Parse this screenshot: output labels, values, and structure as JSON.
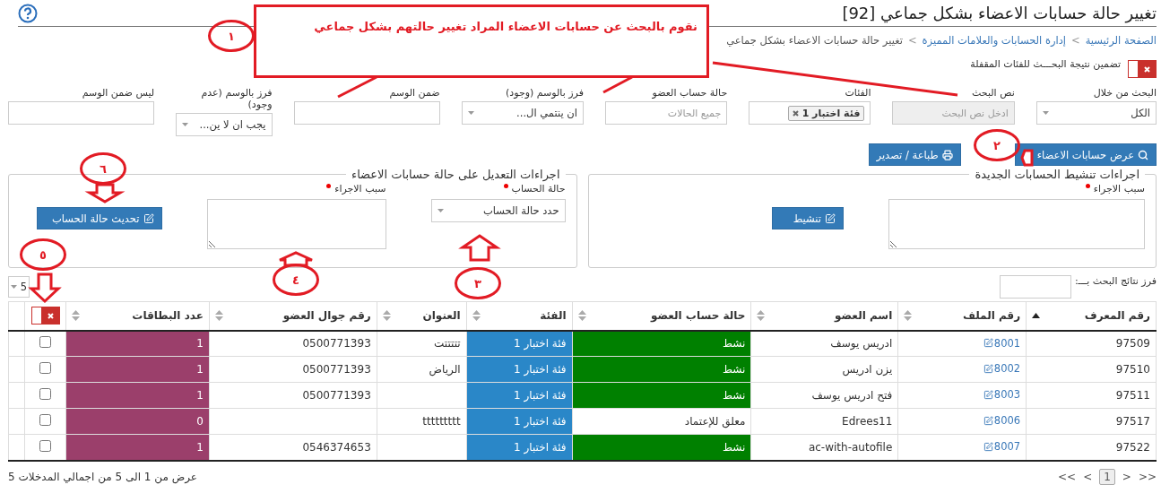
{
  "page": {
    "title": "تغيير حالة حسابات الاعضاء بشكل جماعي [92]"
  },
  "breadcrumb": {
    "separator": ">",
    "items": [
      {
        "label": "الصفحة الرئيسية",
        "link": true
      },
      {
        "label": "إدارة الحسابات والعلامات المميزة",
        "link": true
      },
      {
        "label": "تغيير حالة حسابات الاعضاء بشكل جماعي",
        "link": false
      }
    ]
  },
  "include_locked": {
    "label": "تضمين نتيجة البحـــث للفئات المقفلة",
    "on": false
  },
  "filters": [
    {
      "label": "البحث من خلال",
      "kind": "select",
      "value": "الكل",
      "disabled": false
    },
    {
      "label": "نص البحث",
      "kind": "text",
      "placeholder": "ادخل نص البحث",
      "disabled": true
    },
    {
      "label": "الفئات",
      "kind": "tags",
      "tags": [
        "فئة اختبار 1"
      ],
      "disabled": false
    },
    {
      "label": "حالة حساب العضو",
      "kind": "text",
      "placeholder": "جميع الحالات",
      "disabled": false
    },
    {
      "label": "فرز بالوسم (وجود)",
      "kind": "select",
      "value": "ان ينتمي ال...",
      "disabled": false
    },
    {
      "label": "ضمن الوسم",
      "kind": "text",
      "disabled": false
    },
    {
      "label": "فرز بالوسم (عدم وجود)",
      "kind": "select",
      "value": "يجب ان لا ين...",
      "disabled": false
    },
    {
      "label": "ليس ضمن الوسم",
      "kind": "text",
      "disabled": false
    }
  ],
  "actions": [
    {
      "label": "عرض حسابات الاعضاء",
      "kind": "search"
    },
    {
      "label": "طباعة / تصدير",
      "kind": "print"
    }
  ],
  "activate_panel": {
    "legend": "اجراءات تنشيط الحسابات الجديدة",
    "reason_label": "سبب الاجراء",
    "button": "تنشيط"
  },
  "status_panel": {
    "legend": "اجراءات التعديل على حالة حسابات الاعضاء",
    "status_label": "حالة الحساب",
    "status_value": "حدد حالة الحساب",
    "reason_label": "سبب الاجراء",
    "button": "تحديث حالة الحساب"
  },
  "sort_by": {
    "label": "فرز نتائج البحث بـــ:"
  },
  "page_size": {
    "value": "5"
  },
  "table": {
    "columns": [
      {
        "label": "رقم المعرف",
        "sorted": true
      },
      {
        "label": "رقم الملف",
        "sorted": false
      },
      {
        "label": "اسم العضو",
        "sorted": false
      },
      {
        "label": "حالة حساب العضو",
        "sorted": false
      },
      {
        "label": "الفئة",
        "sorted": false
      },
      {
        "label": "العنوان",
        "sorted": false
      },
      {
        "label": "رقم جوال العضو",
        "sorted": false
      },
      {
        "label": "عدد البطاقات",
        "sorted": false
      }
    ],
    "select_all": {
      "on": false
    },
    "rows": [
      {
        "id": "97509",
        "file": "8001",
        "name": "ادريس يوسف",
        "status": "نشط",
        "active": true,
        "category": "فئة اختبار 1",
        "address": "تتتتتت",
        "mobile": "0500771393",
        "cards": "1",
        "checked": false
      },
      {
        "id": "97510",
        "file": "8002",
        "name": "يزن ادريس",
        "status": "نشط",
        "active": true,
        "category": "فئة اختبار 1",
        "address": "الرياض",
        "mobile": "0500771393",
        "cards": "1",
        "checked": false
      },
      {
        "id": "97511",
        "file": "8003",
        "name": "فتح ادريس يوسف",
        "status": "نشط",
        "active": true,
        "category": "فئة اختبار 1",
        "mobile": "0500771393",
        "cards": "1",
        "checked": false
      },
      {
        "id": "97517",
        "file": "8006",
        "name": "Edrees11",
        "status": "معلق للإعتماد",
        "active": false,
        "category": "فئة اختبار 1",
        "address": "ttttttttt",
        "cards": "0",
        "checked": false
      },
      {
        "id": "97522",
        "file": "8007",
        "name": "ac-with-autofile",
        "status": "نشط",
        "active": true,
        "category": "فئة اختبار 1",
        "mobile": "0546374653",
        "cards": "1",
        "checked": false
      }
    ]
  },
  "summary": "عرض من 1 الى 5 من اجمالي المدخلات 5",
  "pagination": [
    {
      "label": ">>",
      "selected": false
    },
    {
      "label": ">",
      "selected": false
    },
    {
      "label": "1",
      "selected": true
    },
    {
      "label": "<",
      "selected": false
    },
    {
      "label": "<<",
      "selected": false
    }
  ],
  "annotations": {
    "callout": "نقوم بالبحث عن حسابات الاعضاء المراد تغيير حالتهم بشكل جماعي",
    "markers": [
      "١",
      "٢",
      "٣",
      "٤",
      "٥",
      "٦"
    ]
  }
}
